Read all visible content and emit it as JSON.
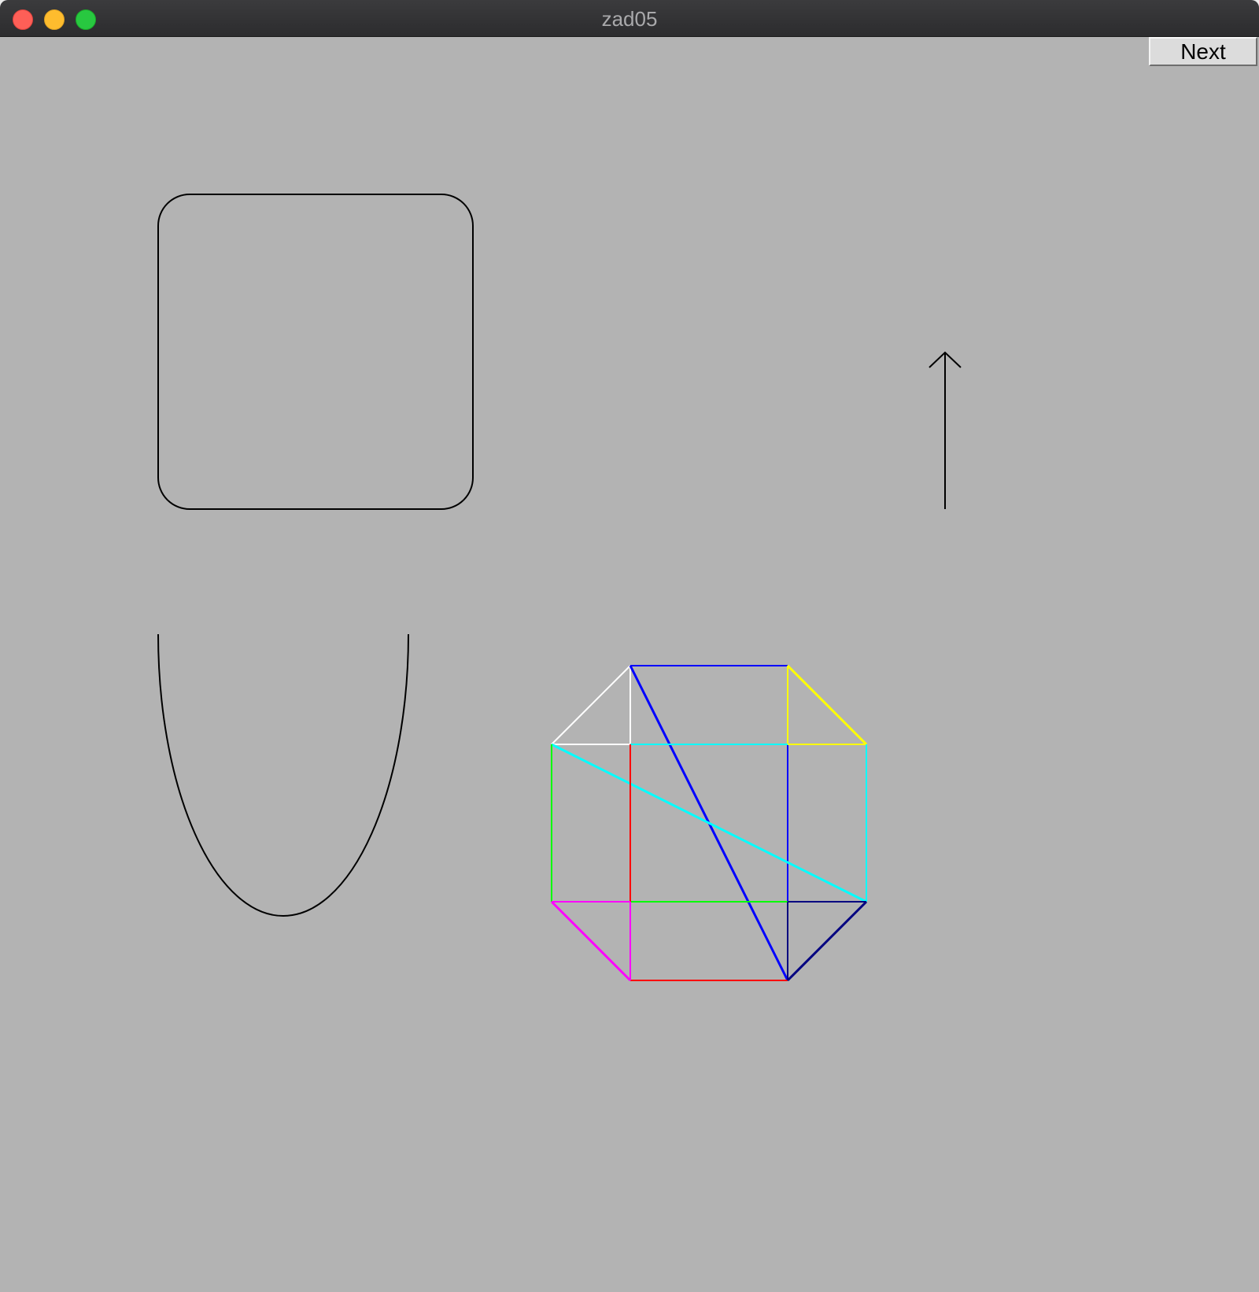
{
  "window": {
    "title": "zad05",
    "background": "#b3b3b3"
  },
  "toolbar": {
    "next_label": "Next"
  },
  "shape_colors": {
    "outline": "#000000",
    "white": "#ffffff",
    "blue": "#0000ff",
    "yellow": "#ffff00",
    "cyan": "#00ffff",
    "green": "#00ff00",
    "red": "#ff0000",
    "magenta": "#ff00ff",
    "navy": "#000080"
  }
}
